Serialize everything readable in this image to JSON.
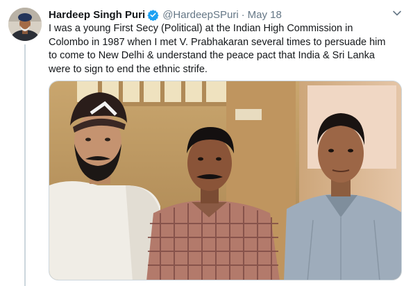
{
  "tweet": {
    "author_name": "Hardeep Singh Puri",
    "handle": "@HardeepSPuri",
    "separator": "·",
    "date": "May 18",
    "text_lines": [
      "I was a young First Secy (Political) at the Indian High Commission in",
      "Colombo in 1987 when I met V. Prabhakaran several times to persuade him",
      "to come to New Delhi & understand the peace pact that India & Sri Lanka",
      "were to sign to end the ethnic strife."
    ]
  },
  "icons": {
    "verified": "verified-badge-icon",
    "menu": "chevron-down-icon"
  },
  "colors": {
    "verified_blue": "#1da1f2",
    "secondary_text": "#657786",
    "thread_line": "#ccd6dd"
  }
}
